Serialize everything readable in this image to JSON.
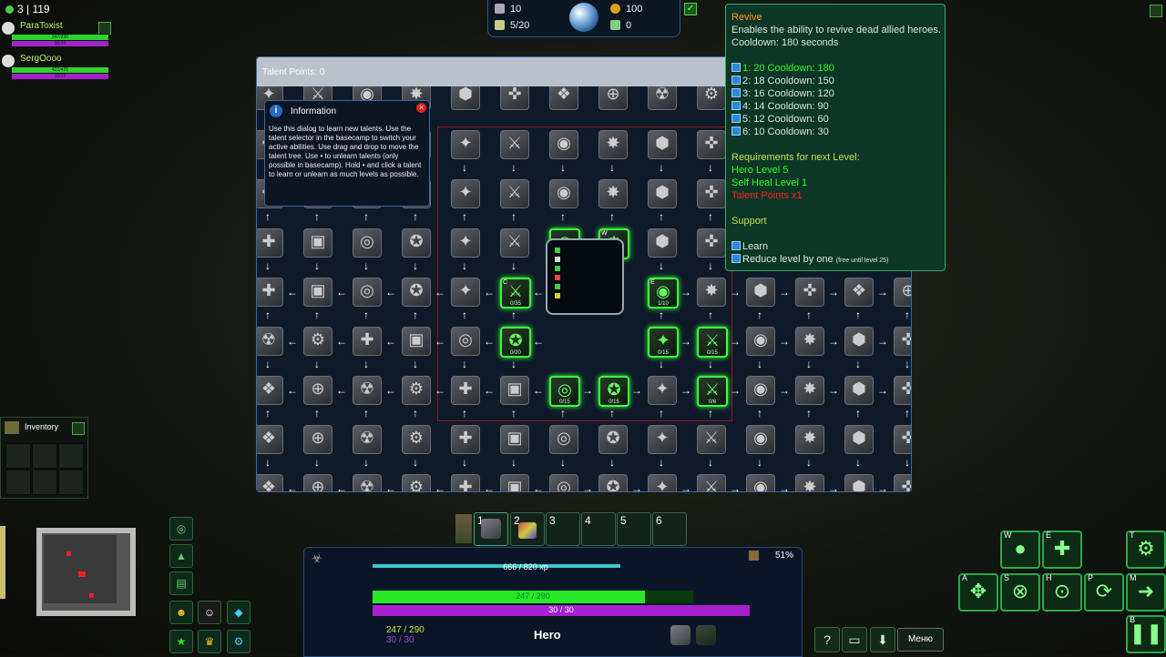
{
  "players": {
    "count": "3 | 119",
    "list": [
      {
        "name": "ParaToxist",
        "hp": "247/290",
        "mp": "30/30"
      },
      {
        "name": "SergOooo",
        "hp": "421/421",
        "mp": "15/15"
      }
    ]
  },
  "resources": {
    "minerals": "10",
    "supply": "5/20",
    "gold": "100",
    "kills": "0"
  },
  "talent": {
    "points_label": "Talent Points: 0",
    "info": {
      "title": "Information",
      "body": "Use this dialog to learn new talents. Use the talent selector in the basecamp to switch your active abilities. Use drag and drop to move the talent tree. Use • to unlearn talents (only possible in basecamp). Hold • and click a talent to learn or unlearn as much levels as possible."
    },
    "tiles": [
      {
        "key": "",
        "lv": "",
        "act": false
      },
      {
        "key": "C",
        "lv": "0/35",
        "act": true
      },
      {
        "key": "E",
        "lv": "1/10",
        "act": true
      },
      {
        "key": "W",
        "lv": "1/10",
        "act": true
      },
      {
        "key": "",
        "lv": "0/15",
        "act": true
      },
      {
        "key": "",
        "lv": "0/20",
        "act": true
      },
      {
        "key": "",
        "lv": "0/15",
        "act": true
      },
      {
        "key": "",
        "lv": "0/15",
        "act": true
      },
      {
        "key": "",
        "lv": "0/15",
        "act": true
      },
      {
        "key": "",
        "lv": "0/15",
        "act": true
      },
      {
        "key": "",
        "lv": "0/6",
        "act": true
      }
    ]
  },
  "tooltip": {
    "title": "Revive",
    "desc": "Enables the ability to revive dead allied heroes.",
    "cooldown": "Cooldown: 180 seconds",
    "levels": [
      "1: 20 Cooldown: 180",
      "2: 18 Cooldown: 150",
      "3: 16 Cooldown: 120",
      "4: 14 Cooldown: 90",
      "5: 12 Cooldown: 60",
      "6: 10 Cooldown: 30"
    ],
    "req_header": "Requirements for next Level:",
    "req1": "Hero Level 5",
    "req2": "Self Heal Level 1",
    "req3": "Talent Points x1",
    "category": "Support",
    "learn": "Learn",
    "reduce": "Reduce level by one",
    "reduce_note": "(free until level 25)"
  },
  "inventory": {
    "title": "Inventory"
  },
  "slots": [
    "1",
    "2",
    "3",
    "4",
    "5",
    "6"
  ],
  "hud": {
    "xp": "666 / 820 xp",
    "xp_frac": 0.81,
    "hp": "247 / 290",
    "hp_frac": 0.85,
    "mp": "30 / 30",
    "mp_frac": 1.0,
    "hp_small": "247 / 290",
    "mp_small": "30 / 30",
    "hero": "Hero",
    "percent": "51%"
  },
  "commands": {
    "w": "W",
    "e": "E",
    "t": "T",
    "a": "A",
    "s": "S",
    "h": "H",
    "p": "P",
    "m": "M",
    "b": "B",
    "menu": "Меню"
  }
}
